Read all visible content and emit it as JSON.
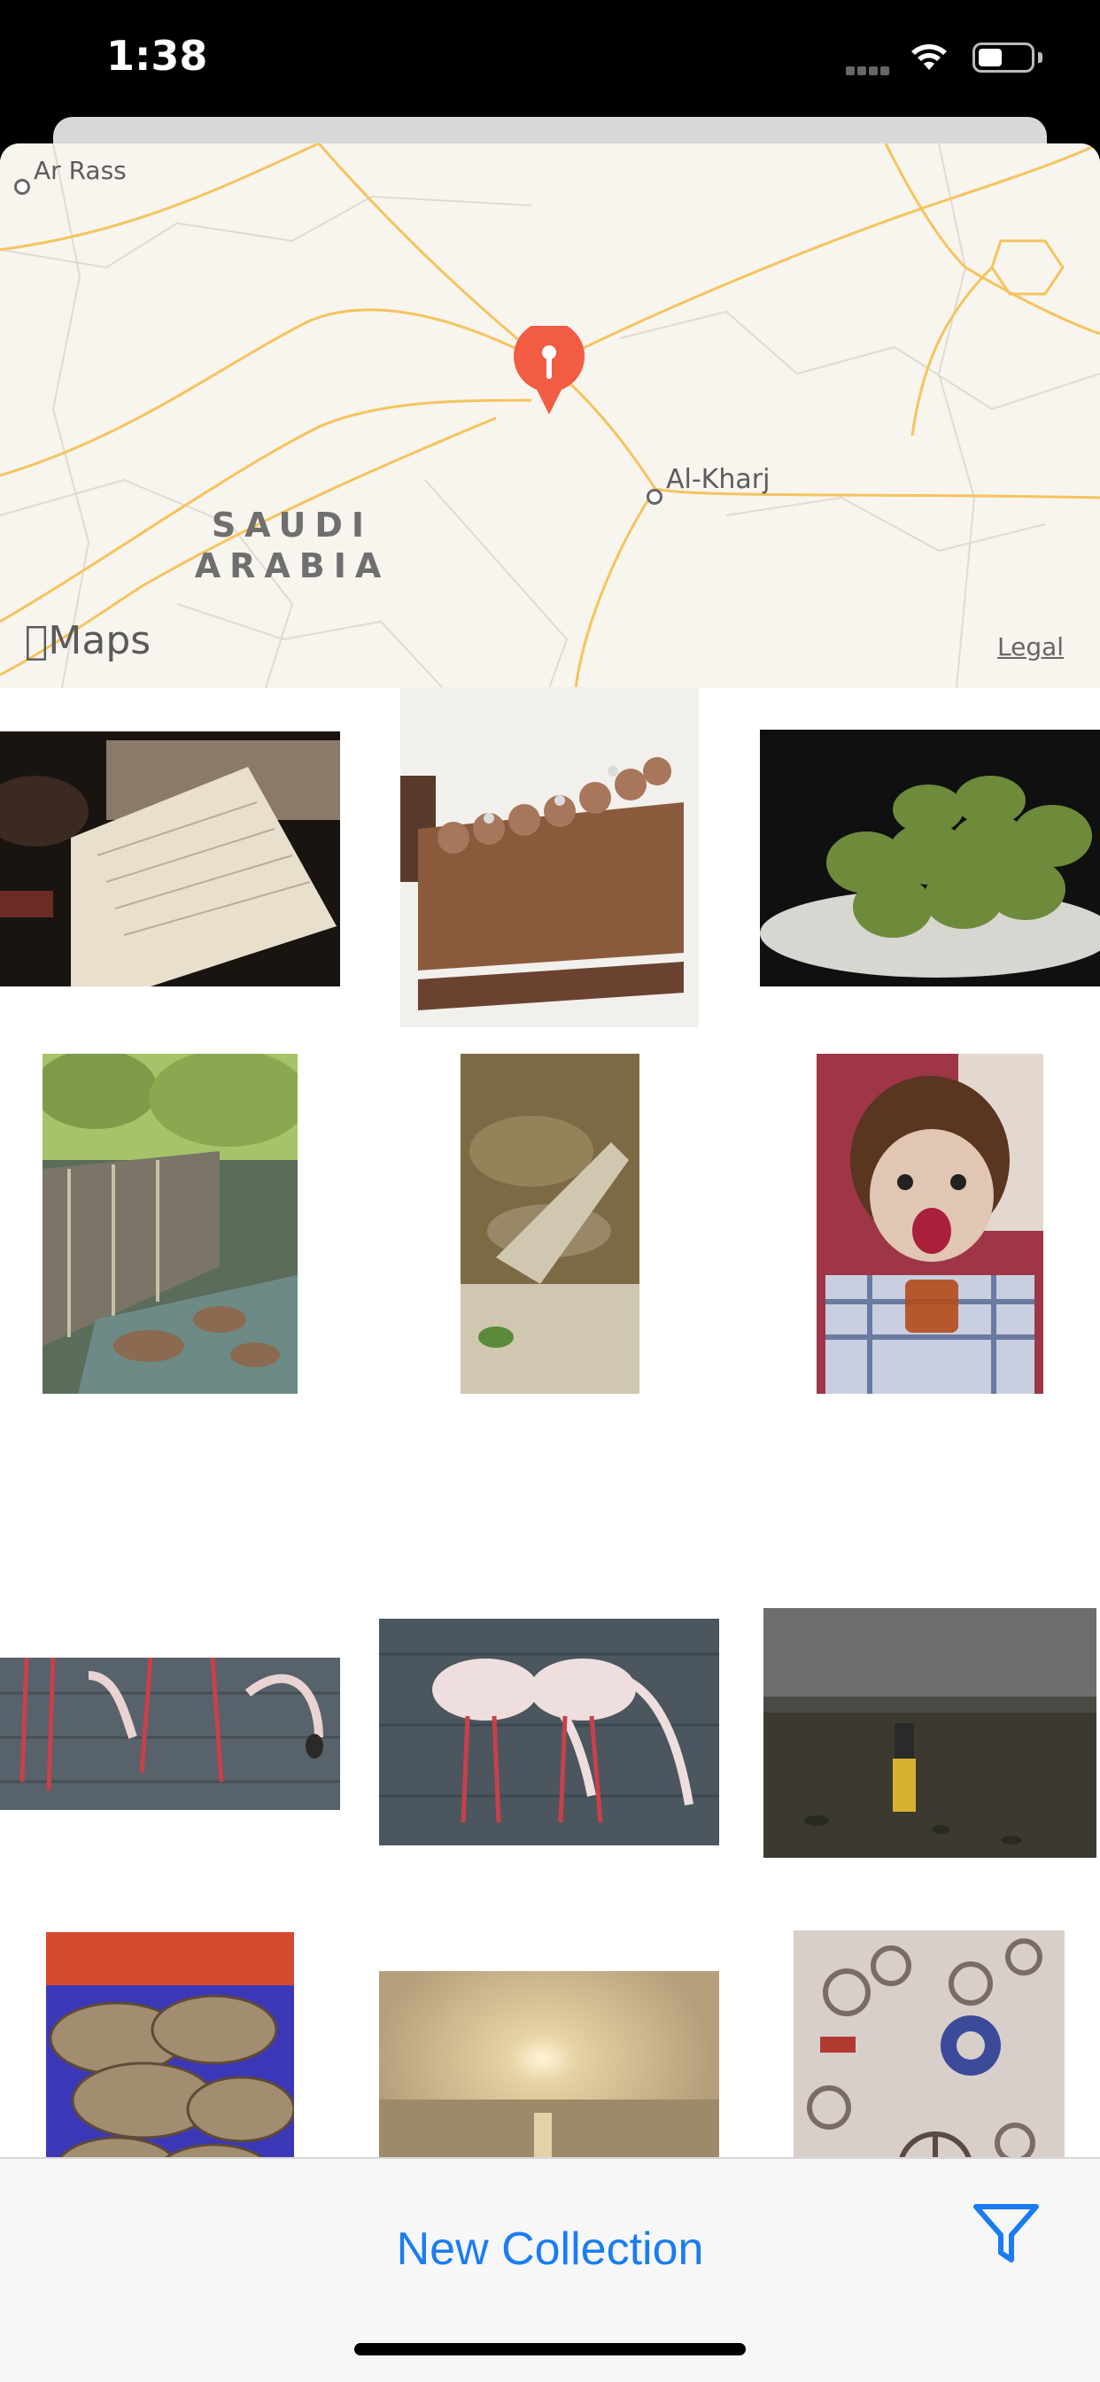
{
  "status": {
    "time": "1:38"
  },
  "map": {
    "places": [
      "Ar Rass",
      "Al-Kharj"
    ],
    "country_line1": "SAUDI",
    "country_line2": "ARABIA",
    "logo": "Maps",
    "legal": "Legal",
    "pin_icon": "map-pin-icon",
    "colors": {
      "background": "#f8f4ee",
      "road": "#f5c45e",
      "border": "#d9d4cc",
      "pin": "#f25c43"
    }
  },
  "photos": [
    {
      "name": "photo-papers",
      "colors": [
        "#1a1410",
        "#e8dfcc"
      ]
    },
    {
      "name": "photo-chocolate-cake",
      "colors": [
        "#f2f0ec",
        "#8b5a3c"
      ]
    },
    {
      "name": "photo-green-pastries",
      "colors": [
        "#101010",
        "#6e8a3b"
      ]
    },
    {
      "name": "photo-fountain",
      "colors": [
        "#a7c36a",
        "#5b6d5a"
      ]
    },
    {
      "name": "photo-water-splash",
      "colors": [
        "#7d6a45",
        "#cfc7b0"
      ]
    },
    {
      "name": "photo-child-tea",
      "colors": [
        "#9e3648",
        "#e0c6b3"
      ]
    },
    {
      "name": "photo-flamingos-1",
      "colors": [
        "#58626a",
        "#e9d3d3"
      ]
    },
    {
      "name": "photo-flamingos-2",
      "colors": [
        "#4b565e",
        "#eedede"
      ]
    },
    {
      "name": "photo-shore-person",
      "colors": [
        "#6a6a6a",
        "#3c3a30"
      ]
    },
    {
      "name": "photo-oysters",
      "colors": [
        "#3b38b8",
        "#a38d70"
      ]
    },
    {
      "name": "photo-sunset-sea",
      "colors": [
        "#c4b08c",
        "#2a2620"
      ]
    },
    {
      "name": "photo-trinkets",
      "colors": [
        "#d9cfca",
        "#7b6b66"
      ]
    }
  ],
  "toolbar": {
    "new_collection": "New Collection",
    "filter_icon": "filter-icon",
    "accent": "#1a7cf2"
  }
}
